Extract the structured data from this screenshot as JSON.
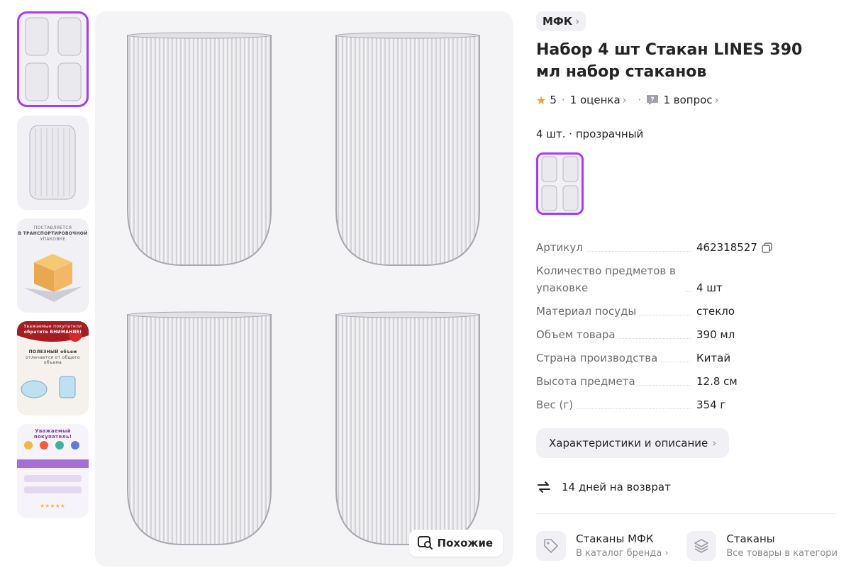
{
  "thumbnails": [
    {
      "alt": "set-of-4-glasses"
    },
    {
      "alt": "single-glass"
    },
    {
      "alt": "packaging",
      "lines": [
        "ПОСТАВЛЯЕТСЯ",
        "В ТРАНСПОРТИРОВОЧНОЙ",
        "УПАКОВКЕ"
      ]
    },
    {
      "alt": "volume-notice",
      "lines": [
        "Уважаемые покупатели",
        "обратите ВНИМАНИЕ!",
        "ПОЛЕЗНЫЙ объем",
        "отличается от общего объема"
      ]
    },
    {
      "alt": "buyer-info",
      "lines": [
        "Уважаемый покупатель!"
      ]
    }
  ],
  "main": {
    "similar_label": "Похожие"
  },
  "product": {
    "brand": "МФК",
    "title": "Набор 4 шт Стакан LINES 390 мл набор стаканов",
    "rating": "5",
    "reviews": "1 оценка",
    "questions": "1 вопрос",
    "variant": "4 шт. · прозрачный"
  },
  "params": [
    {
      "name": "Артикул",
      "value": "462318527",
      "copy": true
    },
    {
      "name": "Количество предметов в упаковке",
      "value": "4 шт"
    },
    {
      "name": "Материал посуды",
      "value": "стекло"
    },
    {
      "name": "Объем товара",
      "value": "390 мл"
    },
    {
      "name": "Страна производства",
      "value": "Китай"
    },
    {
      "name": "Высота предмета",
      "value": "12.8 см"
    },
    {
      "name": "Вес (г)",
      "value": "354 г"
    }
  ],
  "characteristics_button": "Характеристики и описание",
  "returns_text": "14 дней на возврат",
  "cards": [
    {
      "title": "Стаканы МФК",
      "subtitle": "В каталог бренда",
      "icon": "tag-icon"
    },
    {
      "title": "Стаканы",
      "subtitle": "Все товары в категори",
      "icon": "layers-icon"
    }
  ],
  "colors": {
    "accent": "#a73afd",
    "star": "#ff9b25",
    "chip_bg": "#f1f1f5"
  }
}
